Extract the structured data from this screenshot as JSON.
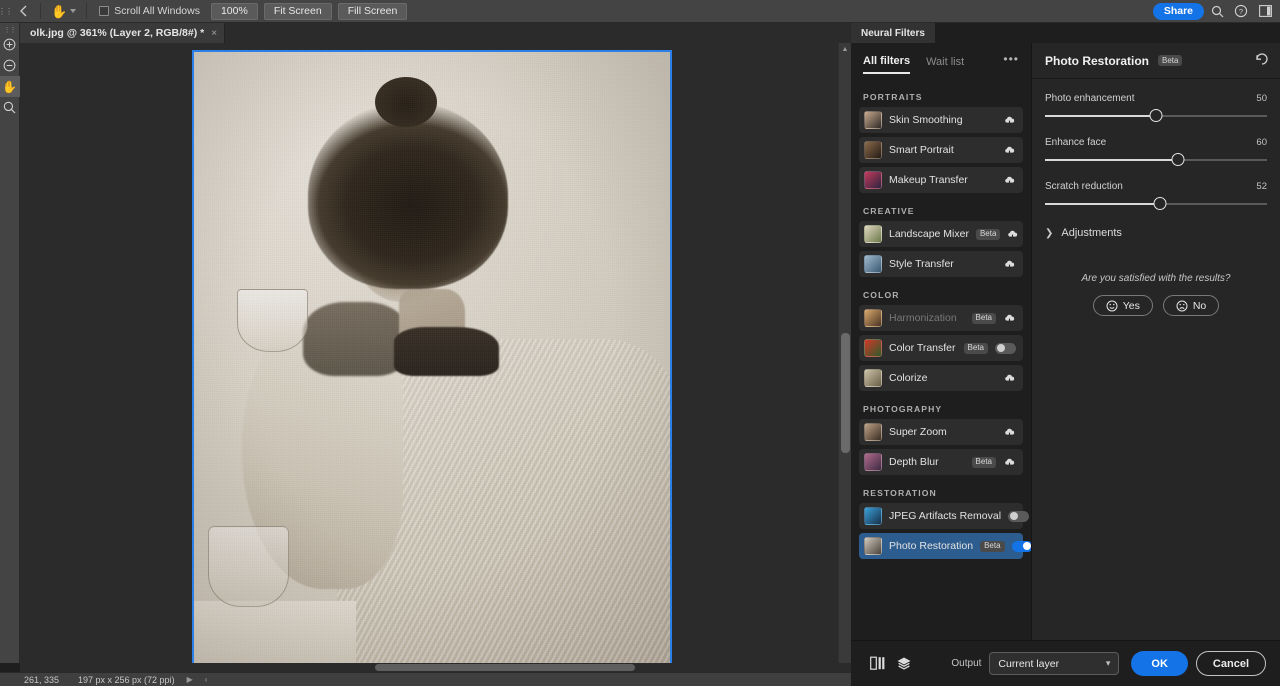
{
  "options_bar": {
    "back_icon": "chevron-left-icon",
    "tool_icon": "hand-tool-icon",
    "scroll_all_windows_label": "Scroll All Windows",
    "zoom_level_label": "100%",
    "fit_screen_label": "Fit Screen",
    "fill_screen_label": "Fill Screen",
    "share_label": "Share",
    "search_icon": "search-icon",
    "help_icon": "help-icon",
    "workspace_icon": "workspace-icon"
  },
  "document_tab": {
    "title": "olk.jpg @ 361% (Layer 2, RGB/8#) *",
    "close_label": "×"
  },
  "toolstrip": {
    "items": [
      {
        "name": "zoom-in-tool",
        "glyph": "+"
      },
      {
        "name": "zoom-out-tool",
        "glyph": "−"
      },
      {
        "name": "hand-tool",
        "glyph": "✋"
      },
      {
        "name": "zoom-tool",
        "glyph": "🔍"
      }
    ]
  },
  "status_bar": {
    "coordinates": "261, 335",
    "doc_size": "197 px x 256 px (72 ppi)"
  },
  "panel": {
    "tab_label": "Neural Filters",
    "filters_tab": "All filters",
    "waitlist_tab": "Wait list",
    "more_icon": "more-options-icon",
    "groups": [
      {
        "title": "PORTRAITS",
        "items": [
          {
            "label": "Skin Smoothing",
            "badge": null,
            "control": "cloud",
            "state": "normal",
            "thumb_a": "#c9a98c",
            "thumb_b": "#2e2a28"
          },
          {
            "label": "Smart Portrait",
            "badge": null,
            "control": "cloud",
            "state": "normal",
            "thumb_a": "#8a6a4a",
            "thumb_b": "#241c16"
          },
          {
            "label": "Makeup Transfer",
            "badge": null,
            "control": "cloud",
            "state": "normal",
            "thumb_a": "#c23b5a",
            "thumb_b": "#2d2440"
          }
        ]
      },
      {
        "title": "CREATIVE",
        "items": [
          {
            "label": "Landscape Mixer",
            "badge": "Beta",
            "control": "cloud",
            "state": "normal",
            "thumb_a": "#dfd6c0",
            "thumb_b": "#6b7a4a"
          },
          {
            "label": "Style Transfer",
            "badge": null,
            "control": "cloud",
            "state": "normal",
            "thumb_a": "#9fb7cc",
            "thumb_b": "#3a5a72"
          }
        ]
      },
      {
        "title": "COLOR",
        "items": [
          {
            "label": "Harmonization",
            "badge": "Beta",
            "control": "cloud",
            "state": "disabled",
            "thumb_a": "#d8a86a",
            "thumb_b": "#4a3426"
          },
          {
            "label": "Color Transfer",
            "badge": "Beta",
            "control": "toggle-off",
            "state": "normal",
            "thumb_a": "#cf3a2a",
            "thumb_b": "#2f5a2a"
          },
          {
            "label": "Colorize",
            "badge": null,
            "control": "cloud",
            "state": "normal",
            "thumb_a": "#cbc2a8",
            "thumb_b": "#6a5f48"
          }
        ]
      },
      {
        "title": "PHOTOGRAPHY",
        "items": [
          {
            "label": "Super Zoom",
            "badge": null,
            "control": "cloud",
            "state": "normal",
            "thumb_a": "#bda287",
            "thumb_b": "#3a2d22"
          },
          {
            "label": "Depth Blur",
            "badge": "Beta",
            "control": "cloud",
            "state": "normal",
            "thumb_a": "#b06a8a",
            "thumb_b": "#3d2a44"
          }
        ]
      },
      {
        "title": "RESTORATION",
        "items": [
          {
            "label": "JPEG Artifacts Removal",
            "badge": null,
            "control": "toggle-off",
            "state": "normal",
            "thumb_a": "#3aa0d8",
            "thumb_b": "#16304a"
          },
          {
            "label": "Photo Restoration",
            "badge": "Beta",
            "control": "toggle-on",
            "state": "selected",
            "thumb_a": "#cfc8bc",
            "thumb_b": "#4a443c"
          }
        ]
      }
    ]
  },
  "settings": {
    "title": "Photo Restoration",
    "badge": "Beta",
    "reset_icon": "reset-icon",
    "sliders": [
      {
        "label": "Photo enhancement",
        "value": 50,
        "min": 0,
        "max": 100
      },
      {
        "label": "Enhance face",
        "value": 60,
        "min": 0,
        "max": 100
      },
      {
        "label": "Scratch reduction",
        "value": 52,
        "min": 0,
        "max": 100
      }
    ],
    "adjustments_label": "Adjustments",
    "adjustments_chevron": "chevron-right-icon",
    "feedback_question": "Are you satisfied with the results?",
    "yes_label": "Yes",
    "no_label": "No"
  },
  "action_bar": {
    "preview_icon": "split-preview-icon",
    "layers_icon": "layers-icon",
    "output_label": "Output",
    "output_value": "Current layer",
    "ok_label": "OK",
    "cancel_label": "Cancel"
  },
  "colors": {
    "accent_blue": "#1473e6",
    "selection_blue": "#2d5c8f",
    "canvas_border": "#2a7fe8"
  }
}
